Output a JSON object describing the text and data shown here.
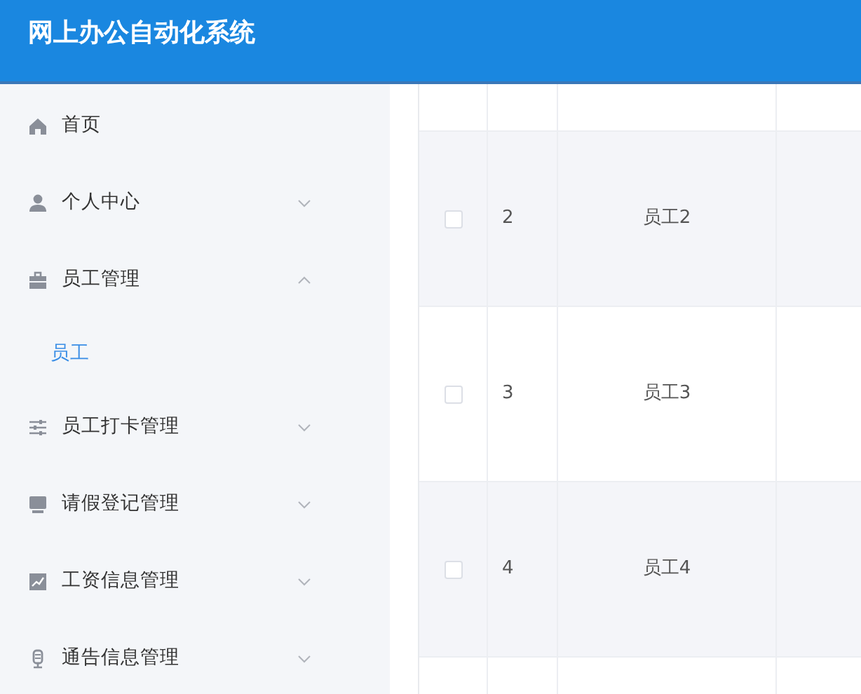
{
  "header": {
    "title": "网上办公自动化系统"
  },
  "sidebar": {
    "items": [
      {
        "label": "首页",
        "kind": "link"
      },
      {
        "label": "个人中心",
        "kind": "submenu",
        "expanded": false
      },
      {
        "label": "员工管理",
        "kind": "submenu",
        "expanded": true,
        "children": [
          {
            "label": "员工",
            "selected": true
          }
        ]
      },
      {
        "label": "员工打卡管理",
        "kind": "submenu",
        "expanded": false
      },
      {
        "label": "请假登记管理",
        "kind": "submenu",
        "expanded": false
      },
      {
        "label": "工资信息管理",
        "kind": "submenu",
        "expanded": false
      },
      {
        "label": "通告信息管理",
        "kind": "submenu",
        "expanded": false
      }
    ]
  },
  "table": {
    "rows": [
      {
        "checked": false,
        "index": "2",
        "name": "员工2"
      },
      {
        "checked": false,
        "index": "3",
        "name": "员工3"
      },
      {
        "checked": false,
        "index": "4",
        "name": "员工4"
      }
    ]
  }
}
